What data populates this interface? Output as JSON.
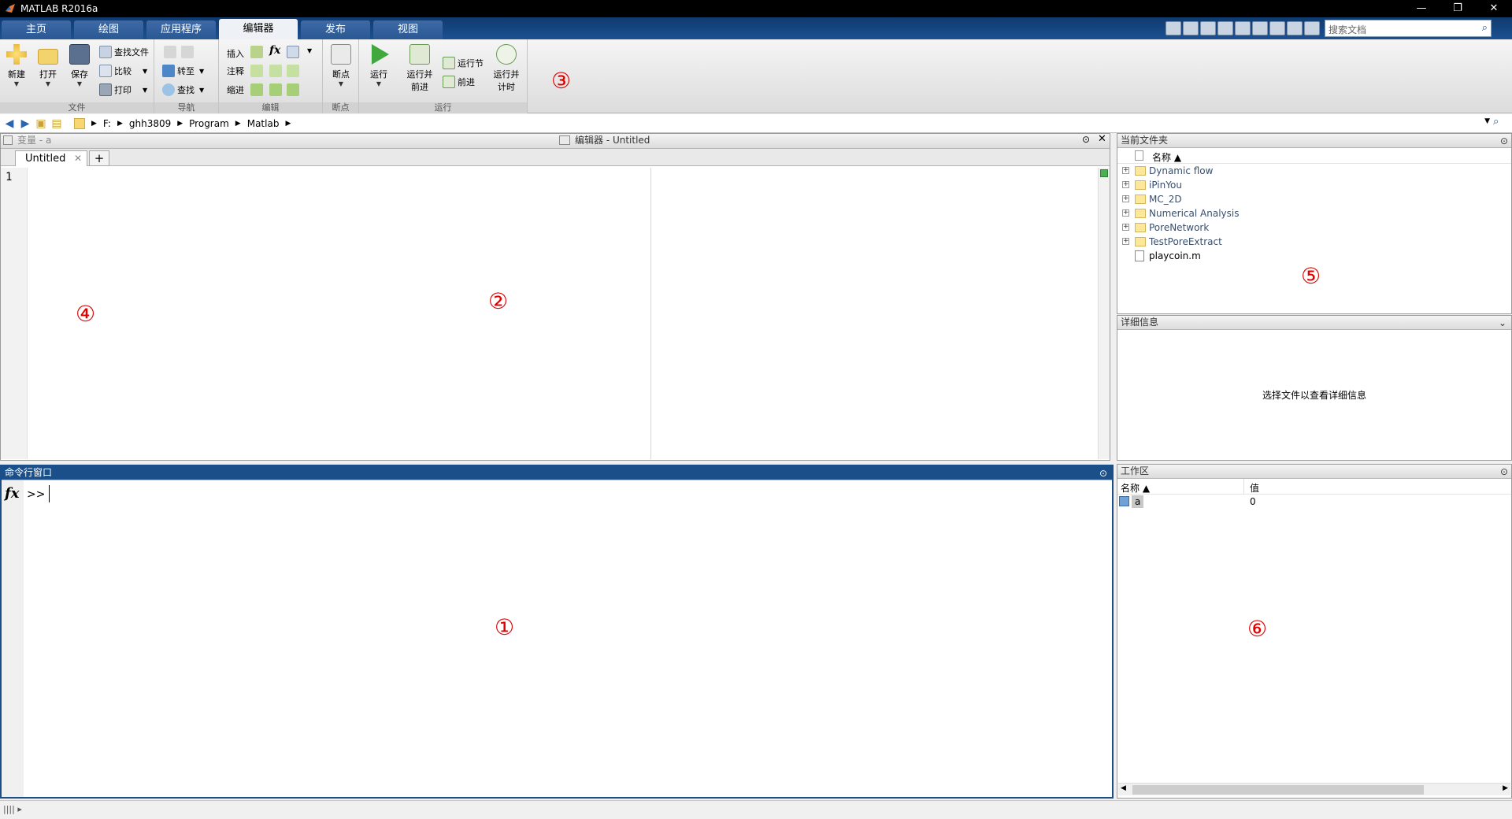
{
  "window": {
    "title": "MATLAB R2016a",
    "minimize": "—",
    "restore": "❐",
    "close": "✕"
  },
  "ribbon_tabs": [
    {
      "label": "主页",
      "active": false
    },
    {
      "label": "绘图",
      "active": false
    },
    {
      "label": "应用程序",
      "active": false
    },
    {
      "label": "编辑器",
      "active": true
    },
    {
      "label": "发布",
      "active": false
    },
    {
      "label": "视图",
      "active": false
    }
  ],
  "search": {
    "placeholder": "搜索文档"
  },
  "ribbon": {
    "file": {
      "label": "文件",
      "new": "新建",
      "open": "打开",
      "save": "保存",
      "find_files": "查找文件",
      "compare": "比较",
      "print": "打印"
    },
    "navigate": {
      "label": "导航",
      "goto": "转至",
      "find": "查找"
    },
    "edit": {
      "label": "编辑",
      "insert": "插入",
      "comment": "注释",
      "indent": "缩进",
      "fx": "fx"
    },
    "breakpoints": {
      "label": "断点",
      "breakpoints": "断点"
    },
    "run": {
      "label": "运行",
      "run": "运行",
      "run_advance_1": "运行并",
      "run_advance_2": "前进",
      "run_section": "运行节",
      "advance": "前进",
      "run_time_1": "运行并",
      "run_time_2": "计时"
    }
  },
  "address": {
    "crumbs": [
      "F:",
      "ghh3809",
      "Program",
      "Matlab"
    ]
  },
  "editor": {
    "variables_title": "变量 - a",
    "editor_title": "编辑器 - Untitled",
    "tab_label": "Untitled",
    "line_number": "1"
  },
  "command_window": {
    "title": "命令行窗口",
    "fx": "fx",
    "prompt": ">>"
  },
  "current_folder": {
    "title": "当前文件夹",
    "name_header": "名称 ▲",
    "folders": [
      "Dynamic flow",
      "iPinYou",
      "MC_2D",
      "Numerical Analysis",
      "PoreNetwork",
      "TestPoreExtract"
    ],
    "files": [
      "playcoin.m"
    ]
  },
  "details": {
    "title": "详细信息",
    "message": "选择文件以查看详细信息"
  },
  "workspace": {
    "title": "工作区",
    "headers": {
      "name": "名称 ▲",
      "value": "值"
    },
    "rows": [
      {
        "name": "a",
        "value": "0"
      }
    ]
  },
  "annotations": [
    "①",
    "②",
    "③",
    "④",
    "⑤",
    "⑥"
  ],
  "colors": {
    "accent": "#1b4f8a",
    "marker": "#e00000"
  }
}
